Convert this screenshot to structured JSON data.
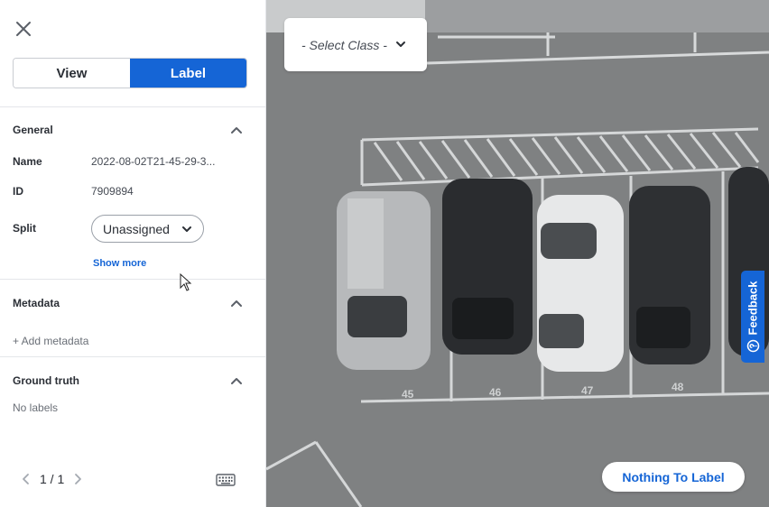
{
  "sidebar": {
    "mode_toggle": {
      "view_label": "View",
      "label_label": "Label",
      "active": "Label"
    },
    "general": {
      "title": "General",
      "name_label": "Name",
      "name_value": "2022-08-02T21-45-29-3...",
      "id_label": "ID",
      "id_value": "7909894",
      "split_label": "Split",
      "split_value": "Unassigned",
      "show_more": "Show more"
    },
    "metadata": {
      "title": "Metadata",
      "add_label": "+ Add metadata"
    },
    "ground_truth": {
      "title": "Ground truth",
      "empty_label": "No labels"
    },
    "pager": {
      "text": "1 / 1"
    }
  },
  "canvas": {
    "class_select_placeholder": "- Select Class -",
    "feedback_label": "Feedback",
    "nothing_to_label": "Nothing To Label",
    "spot_numbers": [
      "45",
      "46",
      "47",
      "48"
    ]
  },
  "colors": {
    "accent": "#1565d6",
    "asphalt": "#7d7f80"
  },
  "icons": [
    "close-icon",
    "chevron-up-icon",
    "chevron-down-icon",
    "chevron-left-icon",
    "chevron-right-icon",
    "keyboard-icon",
    "help-circle-icon",
    "mouse-pointer-icon"
  ]
}
